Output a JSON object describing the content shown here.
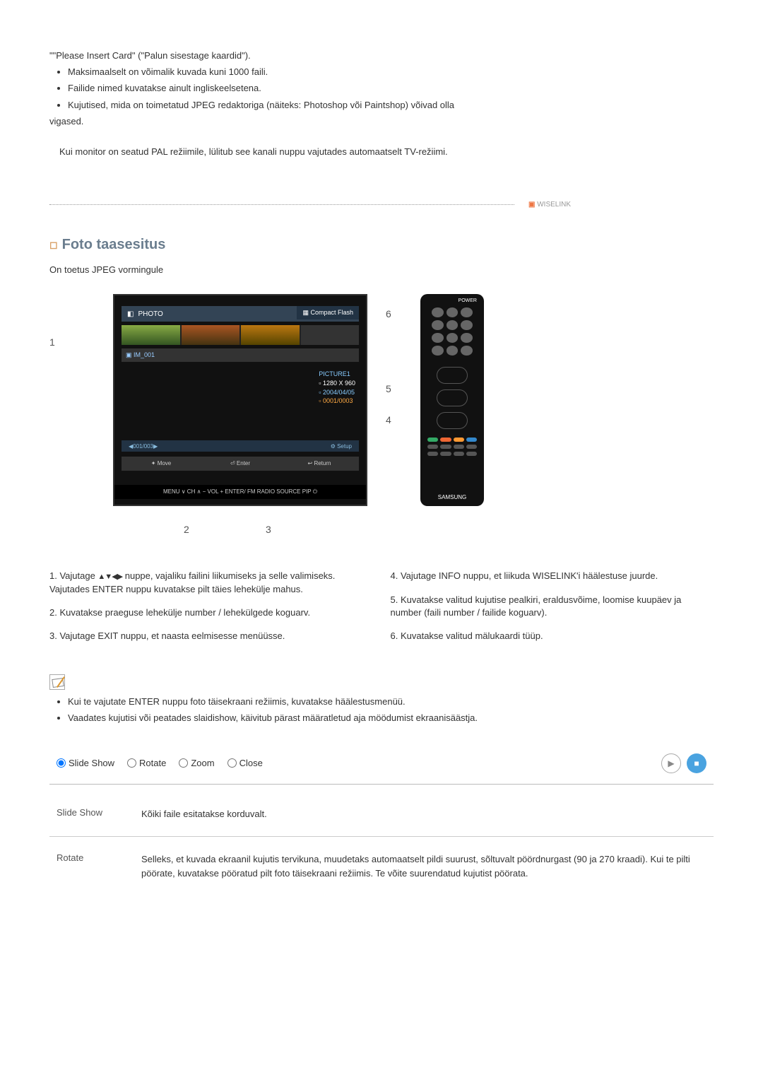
{
  "intro": {
    "insertCard": "\"\"Please Insert Card\" (\"Palun sisestage kaardid\").",
    "bullets": [
      "Maksimaalselt on võimalik kuvada kuni 1000 faili.",
      "Failide nimed kuvatakse ainult ingliskeelsetena.",
      "Kujutised, mida on toimetatud JPEG redaktoriga (näiteks: Photoshop või Paintshop) võivad olla"
    ],
    "vigased": "vigased.",
    "palNote": "Kui monitor on seatud PAL režiimile, lülitub see kanali nuppu vajutades automaatselt TV-režiimi."
  },
  "logo": {
    "brand": "WISELINK"
  },
  "section": {
    "title": "Foto taasesitus",
    "subtitle": "On toetus JPEG vormingule"
  },
  "screenshot": {
    "photoLabel": "PHOTO",
    "cardLabel": "Compact Flash",
    "picName": "PICTURE1",
    "picRes": "1280 X 960",
    "picDate": "2004/04/05",
    "picCount": "0001/0003",
    "pageNum": "001/003",
    "setup": "Setup",
    "move": "Move",
    "enter": "Enter",
    "return": "Return",
    "menuBar": "MENU    ∨  CH  ∧      −  VOL  +      ENTER/ FM RADIO    SOURCE    PIP      ⏻",
    "remoteBrand": "SAMSUNG",
    "power": "POWER",
    "callouts": {
      "c1": "1",
      "c2": "2",
      "c3": "3",
      "c4": "4",
      "c5": "5",
      "c6": "6"
    }
  },
  "navGlyph": "▲▼◀▶",
  "instr": {
    "l1a": "1. Vajutage ",
    "l1b": " nuppe, vajaliku failini liikumiseks ja selle valimiseks. Vajutades ENTER nuppu kuvatakse pilt täies lehekülje mahus.",
    "l2": "2. Kuvatakse praeguse lehekülje number / lehekülgede koguarv.",
    "l3": "3. Vajutage EXIT nuppu, et naasta eelmisesse menüüsse.",
    "r4": "4. Vajutage INFO nuppu, et liikuda WISELINK'i häälestuse juurde.",
    "r5": "5. Kuvatakse valitud kujutise pealkiri, eraldusvõime, loomise kuupäev ja number (faili number / failide koguarv).",
    "r6": "6. Kuvatakse valitud mälukaardi tüüp."
  },
  "notes": {
    "n1": "Kui te vajutate ENTER nuppu foto täisekraani režiimis, kuvatakse häälestusmenüü.",
    "n2": "Vaadates kujutisi või peatades slaidishow, käivitub pärast määratletud aja möödumist ekraanisäästja."
  },
  "radios": {
    "slide": "Slide Show",
    "rotate": "Rotate",
    "zoom": "Zoom",
    "close": "Close"
  },
  "defs": {
    "slideTerm": "Slide Show",
    "slideDesc": "Kõiki faile esitatakse korduvalt.",
    "rotateTerm": "Rotate",
    "rotateDesc": "Selleks, et kuvada ekraanil kujutis tervikuna, muudetaks automaatselt pildi suurust, sõltuvalt pöördnurgast (90 ja 270 kraadi). Kui te pilti pöörate, kuvatakse pööratud pilt foto täisekraani režiimis. Te võite suurendatud kujutist pöörata."
  }
}
